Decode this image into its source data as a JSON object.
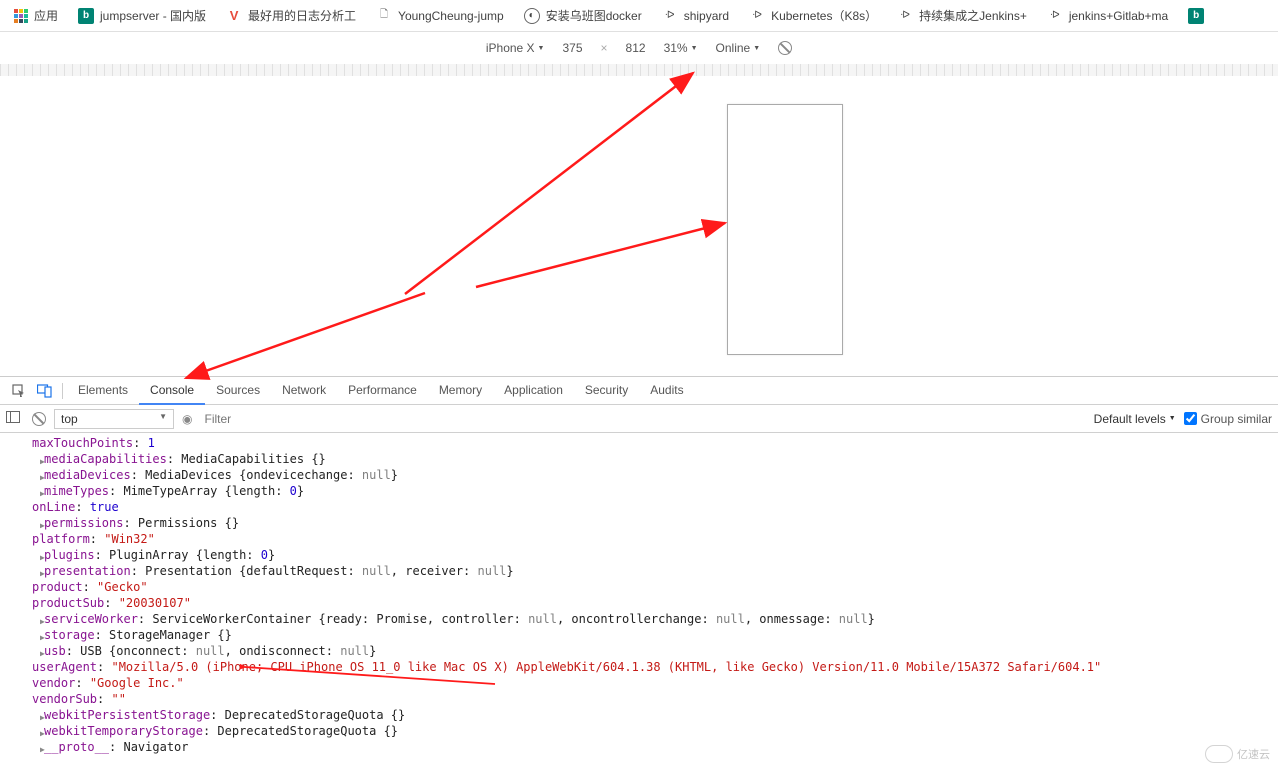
{
  "bookmarks": {
    "apps": "应用",
    "items": [
      {
        "icon": "bing",
        "label": "jumpserver - 国内版"
      },
      {
        "icon": "v",
        "label": "最好用的日志分析工"
      },
      {
        "icon": "page",
        "label": "YoungCheung-jump"
      },
      {
        "icon": "circle",
        "label": "安装乌班图docker"
      },
      {
        "icon": "ship",
        "label": "shipyard"
      },
      {
        "icon": "ship",
        "label": "Kubernetes（K8s）"
      },
      {
        "icon": "ship",
        "label": "持续集成之Jenkins+"
      },
      {
        "icon": "ship",
        "label": "jenkins+Gitlab+ma"
      },
      {
        "icon": "bing",
        "label": ""
      }
    ]
  },
  "device_bar": {
    "device": "iPhone X",
    "width": "375",
    "times": "×",
    "height": "812",
    "zoom": "31%",
    "throttle": "Online"
  },
  "devtools_tabs": [
    "Elements",
    "Console",
    "Sources",
    "Network",
    "Performance",
    "Memory",
    "Application",
    "Security",
    "Audits"
  ],
  "active_tab": "Console",
  "console_bar": {
    "context": "top",
    "filter_placeholder": "Filter",
    "levels": "Default levels",
    "group": "Group similar"
  },
  "console_lines": [
    {
      "expand": false,
      "key": "maxTouchPoints",
      "rest": ": ",
      "val_num": "1"
    },
    {
      "expand": true,
      "key": "mediaCapabilities",
      "rest": ": MediaCapabilities {}"
    },
    {
      "expand": true,
      "key": "mediaDevices",
      "rest": ": MediaDevices {ondevicechange: null}"
    },
    {
      "expand": true,
      "key": "mimeTypes",
      "rest": ": MimeTypeArray {length: ",
      "val_num": "0",
      "tail": "}"
    },
    {
      "expand": false,
      "key": "onLine",
      "rest": ": ",
      "val_bool": "true"
    },
    {
      "expand": true,
      "key": "permissions",
      "rest": ": Permissions {}"
    },
    {
      "expand": false,
      "key": "platform",
      "rest": ": ",
      "val_str": "\"Win32\""
    },
    {
      "expand": true,
      "key": "plugins",
      "rest": ": PluginArray {length: ",
      "val_num": "0",
      "tail": "}"
    },
    {
      "expand": true,
      "key": "presentation",
      "rest": ": Presentation {defaultRequest: null, receiver: null}"
    },
    {
      "expand": false,
      "key": "product",
      "rest": ": ",
      "val_str": "\"Gecko\""
    },
    {
      "expand": false,
      "key": "productSub",
      "rest": ": ",
      "val_str": "\"20030107\""
    },
    {
      "expand": true,
      "key": "serviceWorker",
      "rest": ": ServiceWorkerContainer {ready: Promise, controller: null, oncontrollerchange: null, onmessage: null}"
    },
    {
      "expand": true,
      "key": "storage",
      "rest": ": StorageManager {}"
    },
    {
      "expand": true,
      "key": "usb",
      "rest": ": USB {onconnect: null, ondisconnect: null}"
    },
    {
      "expand": false,
      "key": "userAgent",
      "rest": ": ",
      "val_str": "\"Mozilla/5.0 (iPhone; CPU iPhone OS 11_0 like Mac OS X) AppleWebKit/604.1.38 (KHTML, like Gecko) Version/11.0 Mobile/15A372 Safari/604.1\""
    },
    {
      "expand": false,
      "key": "vendor",
      "rest": ": ",
      "val_str": "\"Google Inc.\""
    },
    {
      "expand": false,
      "key": "vendorSub",
      "rest": ": ",
      "val_str": "\"\""
    },
    {
      "expand": true,
      "key": "webkitPersistentStorage",
      "rest": ": DeprecatedStorageQuota {}"
    },
    {
      "expand": true,
      "key": "webkitTemporaryStorage",
      "rest": ": DeprecatedStorageQuota {}"
    },
    {
      "expand": true,
      "key": "__proto__",
      "rest": ": Navigator"
    }
  ],
  "watermark": "亿速云"
}
